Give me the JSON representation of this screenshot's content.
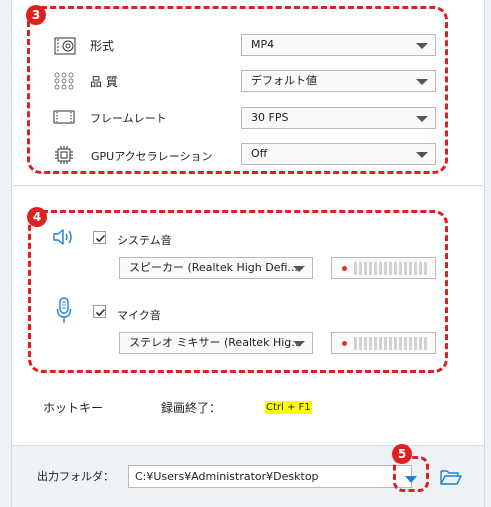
{
  "callouts": [
    "3",
    "4",
    "5"
  ],
  "video_settings": {
    "format": {
      "label": "形式",
      "value": "MP4",
      "icon": "format-icon"
    },
    "quality": {
      "label": "品 質",
      "value": "デフォルト値",
      "icon": "quality-icon"
    },
    "framerate": {
      "label": "フレームレート",
      "value": "30 FPS",
      "icon": "framerate-icon"
    },
    "gpu": {
      "label": "GPUアクセラレーション",
      "value": "Off",
      "icon": "gpu-icon"
    }
  },
  "audio_settings": {
    "system_audio": {
      "label": "システム音",
      "checked": true,
      "device": "スピーカー (Realtek High Defi...",
      "icon": "speaker-icon"
    },
    "mic_audio": {
      "label": "マイク音",
      "checked": true,
      "device": "ステレオ ミキサー (Realtek Hig...",
      "icon": "microphone-icon"
    }
  },
  "hotkey": {
    "title": "ホットキー",
    "stop_label": "録画終了：",
    "stop_value": "Ctrl + F1"
  },
  "output": {
    "label": "出力フォルダ：",
    "path": "C:¥Users¥Administrator¥Desktop"
  },
  "colors": {
    "callout": "#e02020",
    "accent_blue": "#1f7fd6",
    "highlight": "#ffff00"
  }
}
